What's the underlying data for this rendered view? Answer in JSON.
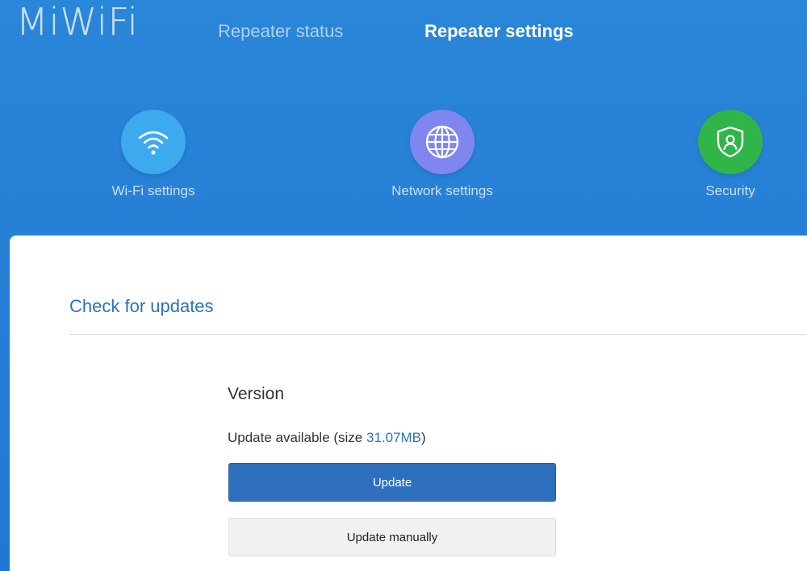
{
  "header": {
    "logo_text": "MiWiFi",
    "tabs": [
      {
        "label": "Repeater status",
        "active": false
      },
      {
        "label": "Repeater settings",
        "active": true
      }
    ]
  },
  "features": [
    {
      "label": "Wi-Fi settings",
      "icon": "wifi-icon",
      "color": "#3daaf0"
    },
    {
      "label": "Network settings",
      "icon": "globe-icon",
      "color": "#7f86f0"
    },
    {
      "label": "Security",
      "icon": "shield-user-icon",
      "color": "#2fb548"
    }
  ],
  "main": {
    "section_title": "Check for updates",
    "version_title": "Version",
    "update_text_prefix": "Update available (size ",
    "update_size": "31.07MB",
    "update_text_suffix": ")",
    "update_button_label": "Update",
    "update_manually_button_label": "Update manually"
  },
  "colors": {
    "header_bg": "#2680d6",
    "accent": "#2b73b8",
    "primary_button": "#2e70bd"
  }
}
